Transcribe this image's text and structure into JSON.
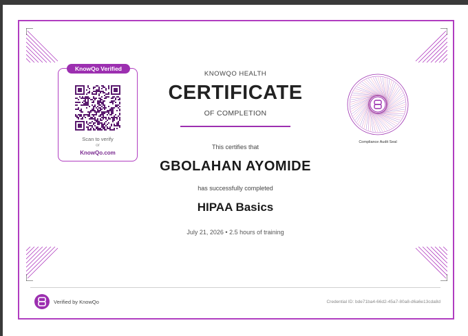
{
  "qr_card": {
    "badge": "KnowQo Verified",
    "scan_text": "Scan to verify",
    "or_text": "or",
    "link_text": "KnowQo.com"
  },
  "certificate": {
    "organization": "KNOWQO HEALTH",
    "title": "CERTIFICATE",
    "subtitle": "OF COMPLETION",
    "certifies_text": "This certifies that",
    "recipient": "GBOLAHAN AYOMIDE",
    "completed_text": "has successfully completed",
    "course": "HIPAA Basics",
    "meta": "July 21, 2026  •  2.5 hours of training"
  },
  "seal": {
    "label": "Compliance Audit Seal"
  },
  "footer": {
    "verified_text": "Verified by KnowQo",
    "credential": "Credential ID: bde71ba4-66d2-45a7-80a8-d6a6e13cda8d"
  },
  "colors": {
    "accent": "#9c2fb0",
    "border": "#b03cc0"
  }
}
